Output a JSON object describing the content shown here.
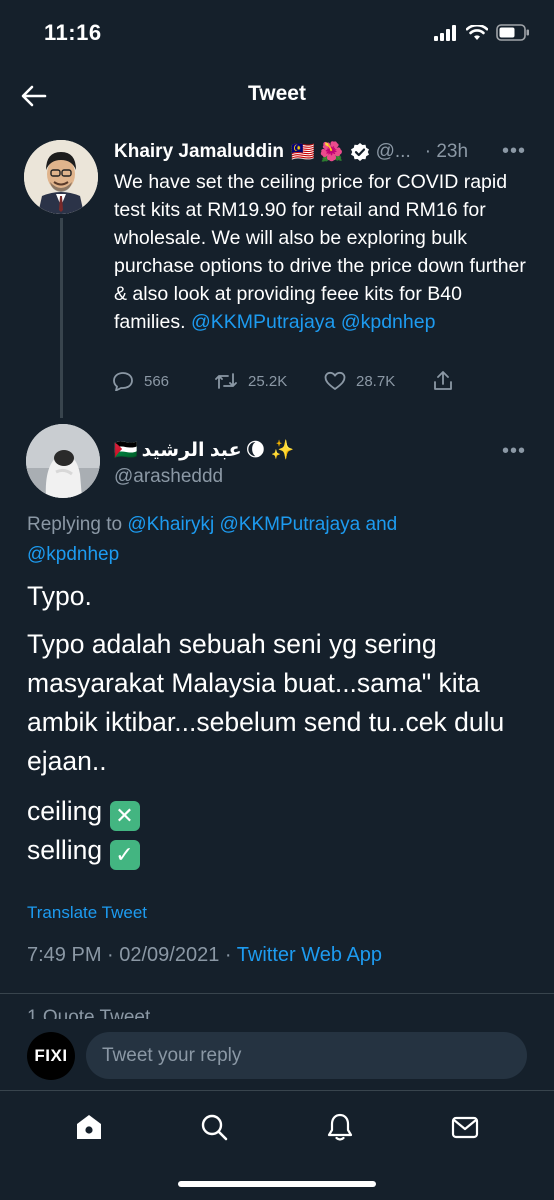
{
  "status_bar": {
    "time": "11:16"
  },
  "header": {
    "title": "Tweet"
  },
  "parent_tweet": {
    "name": "Khairy Jamaluddin",
    "name_emojis": "🇲🇾 🌺",
    "handle": "@...",
    "time": "· 23h",
    "text_plain": "We have set the ceiling price for COVID rapid test kits at RM19.90 for retail and RM16 for wholesale. We will also be exploring bulk purchase options to drive the price down further & also look at providing feee kits for B40 families.",
    "mention_1": "@KKMPutrajaya",
    "mention_2": "@kpdnhep",
    "replies": "566",
    "retweets": "25.2K",
    "likes": "28.7K"
  },
  "main_tweet": {
    "name": "عبد الرشيد",
    "name_flag": "🇵🇸",
    "name_emojis": "🌘 ✨",
    "handle": "@arasheddd",
    "replying_prefix": "Replying to",
    "replying_1": "@Khairykj",
    "replying_2": "@KKMPutrajaya",
    "replying_and": "and",
    "replying_3": "@kpdnhep",
    "line_1": "Typo.",
    "para_2": "Typo adalah sebuah seni yg sering masyarakat Malaysia buat...sama\" kita ambik iktibar...sebelum send tu..cek dulu ejaan..",
    "ceiling": "ceiling",
    "selling": "selling",
    "cross_emoji": "✕",
    "check_emoji": "✓",
    "translate": "Translate Tweet",
    "timestamp": "7:49 PM · 02/09/2021 ·",
    "source": "Twitter Web App",
    "quote_peek": "1 Quote Tweet"
  },
  "reply_bar": {
    "avatar_text": "FIXI",
    "placeholder": "Tweet your reply"
  },
  "colors": {
    "background": "#15202b",
    "link": "#1d9bf0",
    "muted": "#8b98a5",
    "emoji_green": "#43b581"
  },
  "icons": [
    "back-arrow-icon",
    "signal-icon",
    "wifi-icon",
    "battery-icon",
    "verified-icon",
    "more-icon",
    "reply-icon",
    "retweet-icon",
    "like-icon",
    "share-icon",
    "home-icon",
    "search-icon",
    "notifications-icon",
    "messages-icon"
  ]
}
